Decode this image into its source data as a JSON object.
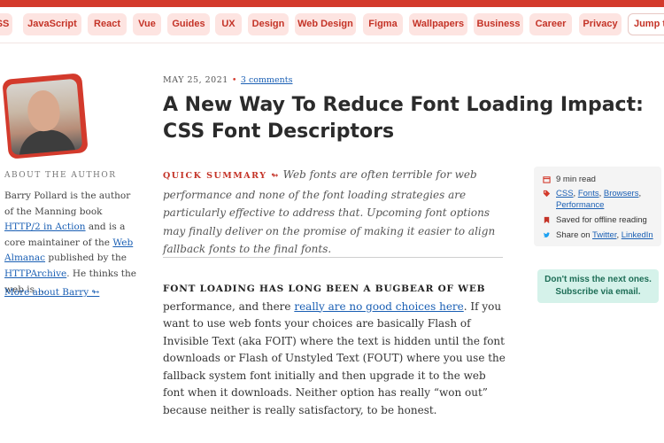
{
  "nav": {
    "tags": [
      "SS",
      "JavaScript",
      "React",
      "Vue",
      "Guides",
      "UX",
      "Design",
      "Web Design",
      "Figma",
      "Wallpapers",
      "Business",
      "Career",
      "Privacy"
    ],
    "jump_label": "Jump t"
  },
  "author": {
    "about_heading": "ABOUT THE AUTHOR",
    "bio_1": "Barry Pollard is the author of the Manning book ",
    "bio_link_1": "HTTP/2 in Action",
    "bio_2": " and is a core maintainer of the ",
    "bio_link_2": "Web Almanac",
    "bio_3": " published by the ",
    "bio_link_3": "HTTPArchive",
    "bio_4": ". He thinks the web is …",
    "more_link": "More about Barry ↬"
  },
  "article": {
    "date": "MAY 25, 2021",
    "comments": "3 comments",
    "title": "A New Way To Reduce Font Loading Impact: CSS Font Descriptors",
    "summary_label": "QUICK SUMMARY ↬",
    "summary_text": " Web fonts are often terrible for web performance and none of the font loading strategies are particularly effective to address that. Upcoming font options may finally deliver on the promise of making it easier to align fallback fonts to the final fonts.",
    "lead": "FONT LOADING HAS LONG BEEN A BUGBEAR OF WEB",
    "body_1": " performance, and there ",
    "body_link": "really are no good choices here",
    "body_2": ". If you want to use web fonts your choices are basically Flash of Invisible Text (aka FOIT) where the text is hidden until the font downloads or Flash of Unstyled Text (FOUT) where you use the fallback system font initially and then upgrade it to the web font when it downloads. Neither option has really “won out” because neither is really satisfactory, to be honest."
  },
  "info": {
    "read_time": "9 min read",
    "tag_1": "CSS",
    "tag_2": "Fonts",
    "tag_3": "Browsers",
    "tag_4": "Performance",
    "saved": "Saved for offline reading",
    "share_prefix": "Share on ",
    "share_1": "Twitter",
    "share_2": "LinkedIn"
  },
  "cta": {
    "line_1": "Don't miss the next ones.",
    "line_2": "Subscribe via email."
  },
  "colors": {
    "accent": "#d33a2c",
    "link": "#1a5fb4",
    "cta_bg": "#d5f2ea",
    "cta_text": "#1e6e57"
  }
}
